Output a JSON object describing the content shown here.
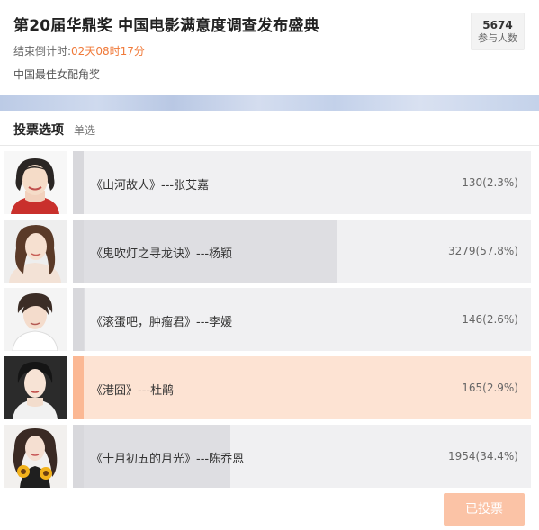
{
  "header": {
    "title": "第20届华鼎奖 中国电影满意度调查发布盛典",
    "countdown_prefix": "结束倒计时:",
    "countdown_time": "02天08时17分",
    "subtitle": "中国最佳女配角奖",
    "participants_count": "5674",
    "participants_label": "参与人数"
  },
  "section": {
    "title": "投票选项",
    "mode": "单选"
  },
  "options": [
    {
      "label": "《山河故人》---张艾嘉",
      "result": "130(2.3%)",
      "percent": 2.3,
      "selected": false
    },
    {
      "label": "《鬼吹灯之寻龙诀》---杨颖",
      "result": "3279(57.8%)",
      "percent": 57.8,
      "selected": false
    },
    {
      "label": "《滚蛋吧，肿瘤君》---李媛",
      "result": "146(2.6%)",
      "percent": 2.6,
      "selected": false
    },
    {
      "label": "《港囧》---杜鹃",
      "result": "165(2.9%)",
      "percent": 2.9,
      "selected": true
    },
    {
      "label": "《十月初五的月光》---陈乔恩",
      "result": "1954(34.4%)",
      "percent": 34.4,
      "selected": false
    }
  ],
  "vote_button": {
    "label": "已投票"
  },
  "colors": {
    "accent": "#f07a3a",
    "selected_bar": "#fde3d3",
    "selected_edge": "#fbb894",
    "button": "#fbc3a6"
  }
}
